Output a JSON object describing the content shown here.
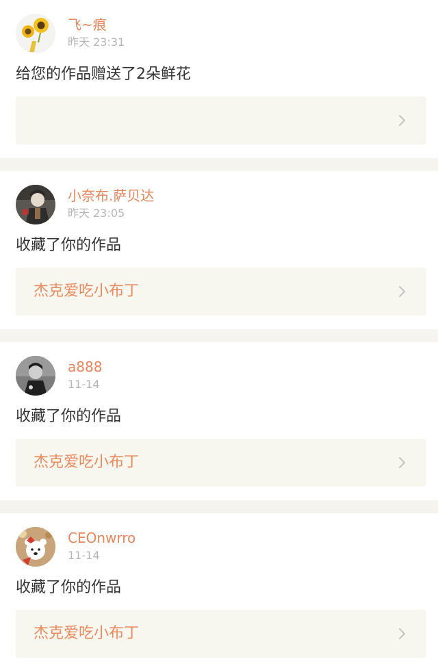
{
  "notifications": [
    {
      "username": "飞~痕",
      "time": "昨天 23:31",
      "action": "给您的作品赠送了2朵鲜花",
      "work_title": "",
      "avatar": "sunflower-avatar"
    },
    {
      "username": "小奈布.萨贝达",
      "time": "昨天 23:05",
      "action": "收藏了你的作品",
      "work_title": "杰克爱吃小布丁",
      "avatar": "anime-character-avatar"
    },
    {
      "username": "a888",
      "time": "11-14",
      "action": "收藏了你的作品",
      "work_title": "杰克爱吃小布丁",
      "avatar": "person-photo-avatar"
    },
    {
      "username": "CEOnwrro",
      "time": "11-14",
      "action": "收藏了你的作品",
      "work_title": "杰克爱吃小布丁",
      "avatar": "cartoon-bear-avatar"
    }
  ],
  "colors": {
    "username": "#e8855c",
    "work_title": "#ec8a5d",
    "work_box_bg": "#f7f6ef",
    "separator": "#f6f4ef",
    "time": "#b6b6b6"
  }
}
